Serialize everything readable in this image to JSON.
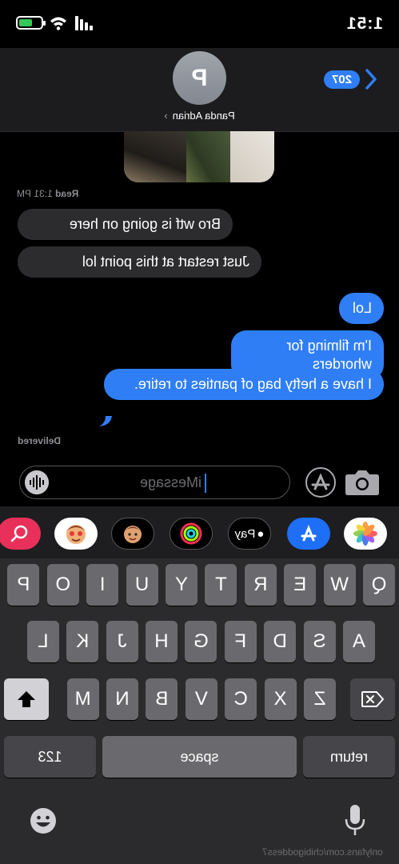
{
  "status_bar": {
    "time": "1:51"
  },
  "header": {
    "back_count": "207",
    "avatar_initial": "P",
    "contact_name": "Panda Adrian",
    "contact_chevron": "›"
  },
  "thread": {
    "read_receipt_label": "Read",
    "read_receipt_time": "1:31 PM",
    "messages": [
      {
        "sender": "them",
        "text": "Bro wtf is going on here"
      },
      {
        "sender": "them",
        "text": "Just restart at this point lol"
      },
      {
        "sender": "me",
        "text": "Lol"
      },
      {
        "sender": "me",
        "text": "I'm filming for whorders"
      },
      {
        "sender": "me",
        "text": "I have a hefty bag of panties to retire."
      }
    ],
    "delivered_label": "Delivered"
  },
  "input_bar": {
    "placeholder": "iMessage"
  },
  "app_strip": {
    "apple_pay_label": "Pay"
  },
  "keyboard": {
    "row1": [
      "Q",
      "W",
      "E",
      "R",
      "T",
      "Y",
      "U",
      "I",
      "O",
      "P"
    ],
    "row2": [
      "A",
      "S",
      "D",
      "F",
      "G",
      "H",
      "J",
      "K",
      "L"
    ],
    "row3": [
      "Z",
      "X",
      "C",
      "V",
      "B",
      "N",
      "M"
    ],
    "numbers_key": "123",
    "space_key": "space",
    "return_key": "return"
  },
  "watermark": "onlyfans.com/chibigoddess7"
}
